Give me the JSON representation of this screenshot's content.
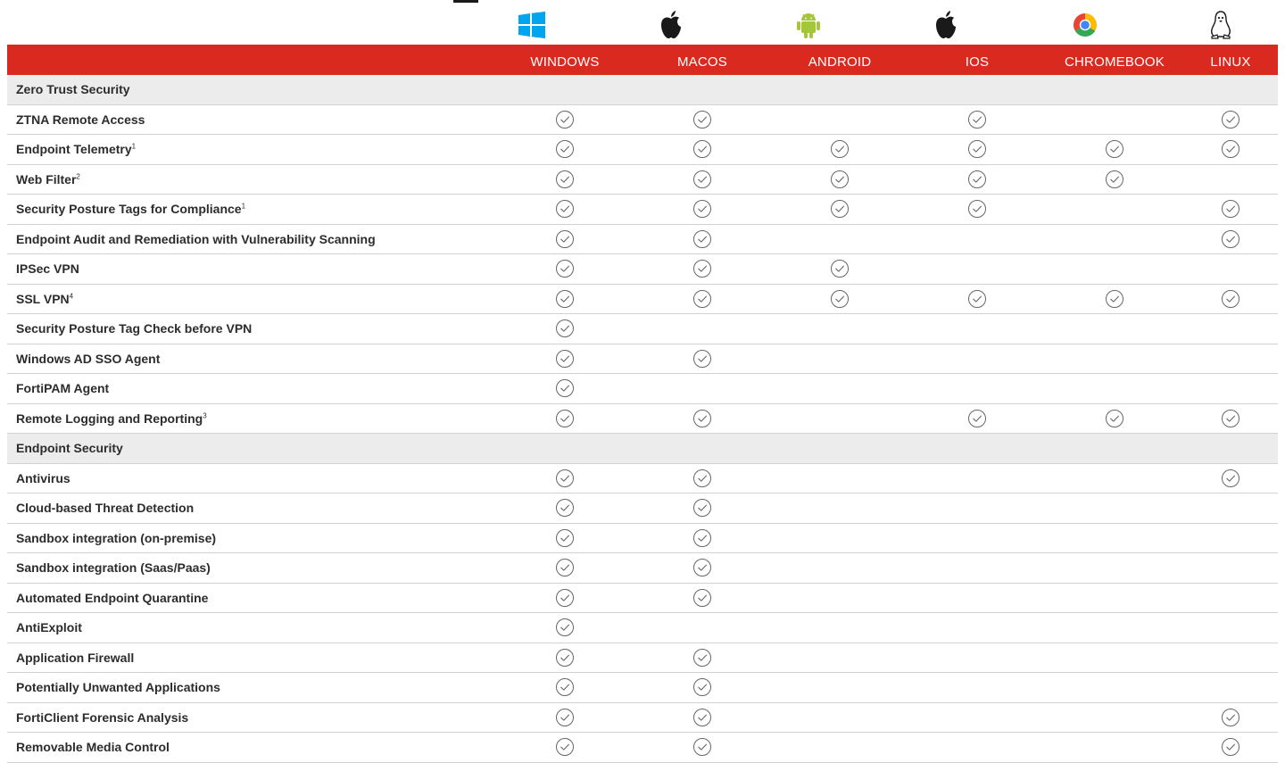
{
  "columns": [
    {
      "key": "windows",
      "label": "WINDOWS",
      "icon": "windows-icon"
    },
    {
      "key": "macos",
      "label": "MACOS",
      "icon": "apple-icon"
    },
    {
      "key": "android",
      "label": "ANDROID",
      "icon": "android-icon"
    },
    {
      "key": "ios",
      "label": "IOS",
      "icon": "apple-icon"
    },
    {
      "key": "chromebook",
      "label": "CHROMEBOOK",
      "icon": "chrome-icon"
    },
    {
      "key": "linux",
      "label": "LINUX",
      "icon": "linux-tux-icon"
    }
  ],
  "colors": {
    "header_bar": "#da2a1f",
    "windows": "#00a4ef",
    "android": "#a4c639",
    "apple": "#1a1a1a",
    "section_bg": "#ececec",
    "check": "#666666"
  },
  "rows": [
    {
      "type": "section",
      "label": "Zero Trust Security"
    },
    {
      "type": "feature",
      "label": "ZTNA Remote Access",
      "sup": "",
      "support": [
        true,
        true,
        false,
        true,
        false,
        true
      ]
    },
    {
      "type": "feature",
      "label": "Endpoint Telemetry",
      "sup": "1",
      "support": [
        true,
        true,
        true,
        true,
        true,
        true
      ]
    },
    {
      "type": "feature",
      "label": "Web Filter",
      "sup": "2",
      "support": [
        true,
        true,
        true,
        true,
        true,
        false
      ]
    },
    {
      "type": "feature",
      "label": "Security Posture Tags for Compliance",
      "sup": "1",
      "support": [
        true,
        true,
        true,
        true,
        false,
        true
      ]
    },
    {
      "type": "feature",
      "label": "Endpoint Audit and Remediation with Vulnerability Scanning",
      "sup": "",
      "support": [
        true,
        true,
        false,
        false,
        false,
        true
      ]
    },
    {
      "type": "feature",
      "label": "IPSec VPN",
      "sup": "",
      "support": [
        true,
        true,
        true,
        false,
        false,
        false
      ]
    },
    {
      "type": "feature",
      "label": "SSL VPN",
      "sup": "4",
      "support": [
        true,
        true,
        true,
        true,
        true,
        true
      ]
    },
    {
      "type": "feature",
      "label": "Security Posture Tag Check before VPN",
      "sup": "",
      "support": [
        true,
        false,
        false,
        false,
        false,
        false
      ]
    },
    {
      "type": "feature",
      "label": "Windows AD SSO Agent",
      "sup": "",
      "support": [
        true,
        true,
        false,
        false,
        false,
        false
      ]
    },
    {
      "type": "feature",
      "label": "FortiPAM Agent",
      "sup": "",
      "support": [
        true,
        false,
        false,
        false,
        false,
        false
      ]
    },
    {
      "type": "feature",
      "label": "Remote Logging and Reporting",
      "sup": "3",
      "support": [
        true,
        true,
        false,
        true,
        true,
        true
      ]
    },
    {
      "type": "section",
      "label": "Endpoint Security"
    },
    {
      "type": "feature",
      "label": "Antivirus",
      "sup": "",
      "support": [
        true,
        true,
        false,
        false,
        false,
        true
      ]
    },
    {
      "type": "feature",
      "label": "Cloud-based Threat Detection",
      "sup": "",
      "support": [
        true,
        true,
        false,
        false,
        false,
        false
      ]
    },
    {
      "type": "feature",
      "label": "Sandbox integration (on-premise)",
      "sup": "",
      "support": [
        true,
        true,
        false,
        false,
        false,
        false
      ]
    },
    {
      "type": "feature",
      "label": "Sandbox integration (Saas/Paas)",
      "sup": "",
      "support": [
        true,
        true,
        false,
        false,
        false,
        false
      ]
    },
    {
      "type": "feature",
      "label": "Automated Endpoint Quarantine",
      "sup": "",
      "support": [
        true,
        true,
        false,
        false,
        false,
        false
      ]
    },
    {
      "type": "feature",
      "label": "AntiExploit",
      "sup": "",
      "support": [
        true,
        false,
        false,
        false,
        false,
        false
      ]
    },
    {
      "type": "feature",
      "label": "Application Firewall",
      "sup": "",
      "support": [
        true,
        true,
        false,
        false,
        false,
        false
      ]
    },
    {
      "type": "feature",
      "label": "Potentially Unwanted Applications",
      "sup": "",
      "support": [
        true,
        true,
        false,
        false,
        false,
        false
      ]
    },
    {
      "type": "feature",
      "label": "FortiClient Forensic Analysis",
      "sup": "",
      "support": [
        true,
        true,
        false,
        false,
        false,
        true
      ]
    },
    {
      "type": "feature",
      "label": "Removable Media Control",
      "sup": "",
      "support": [
        true,
        true,
        false,
        false,
        false,
        true
      ]
    }
  ]
}
